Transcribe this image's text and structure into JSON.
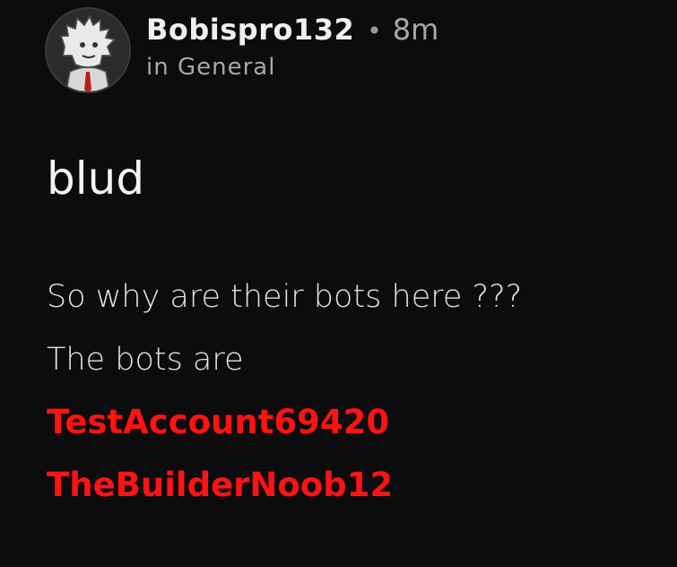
{
  "post": {
    "author": "Bobispro132",
    "separator": "•",
    "time_ago": "8m",
    "category": "in General",
    "title": "blud",
    "body_lines": [
      "So why are their bots here ???",
      "The bots are"
    ],
    "mentions": [
      "TestAccount69420",
      "TheBuilderNoob12"
    ]
  },
  "icons": {
    "avatar": "user-avatar-image"
  },
  "colors": {
    "background": "#0c0b0d",
    "text": "#e9e7ea",
    "muted": "#a9a7ab",
    "mention": "#ff1212"
  }
}
